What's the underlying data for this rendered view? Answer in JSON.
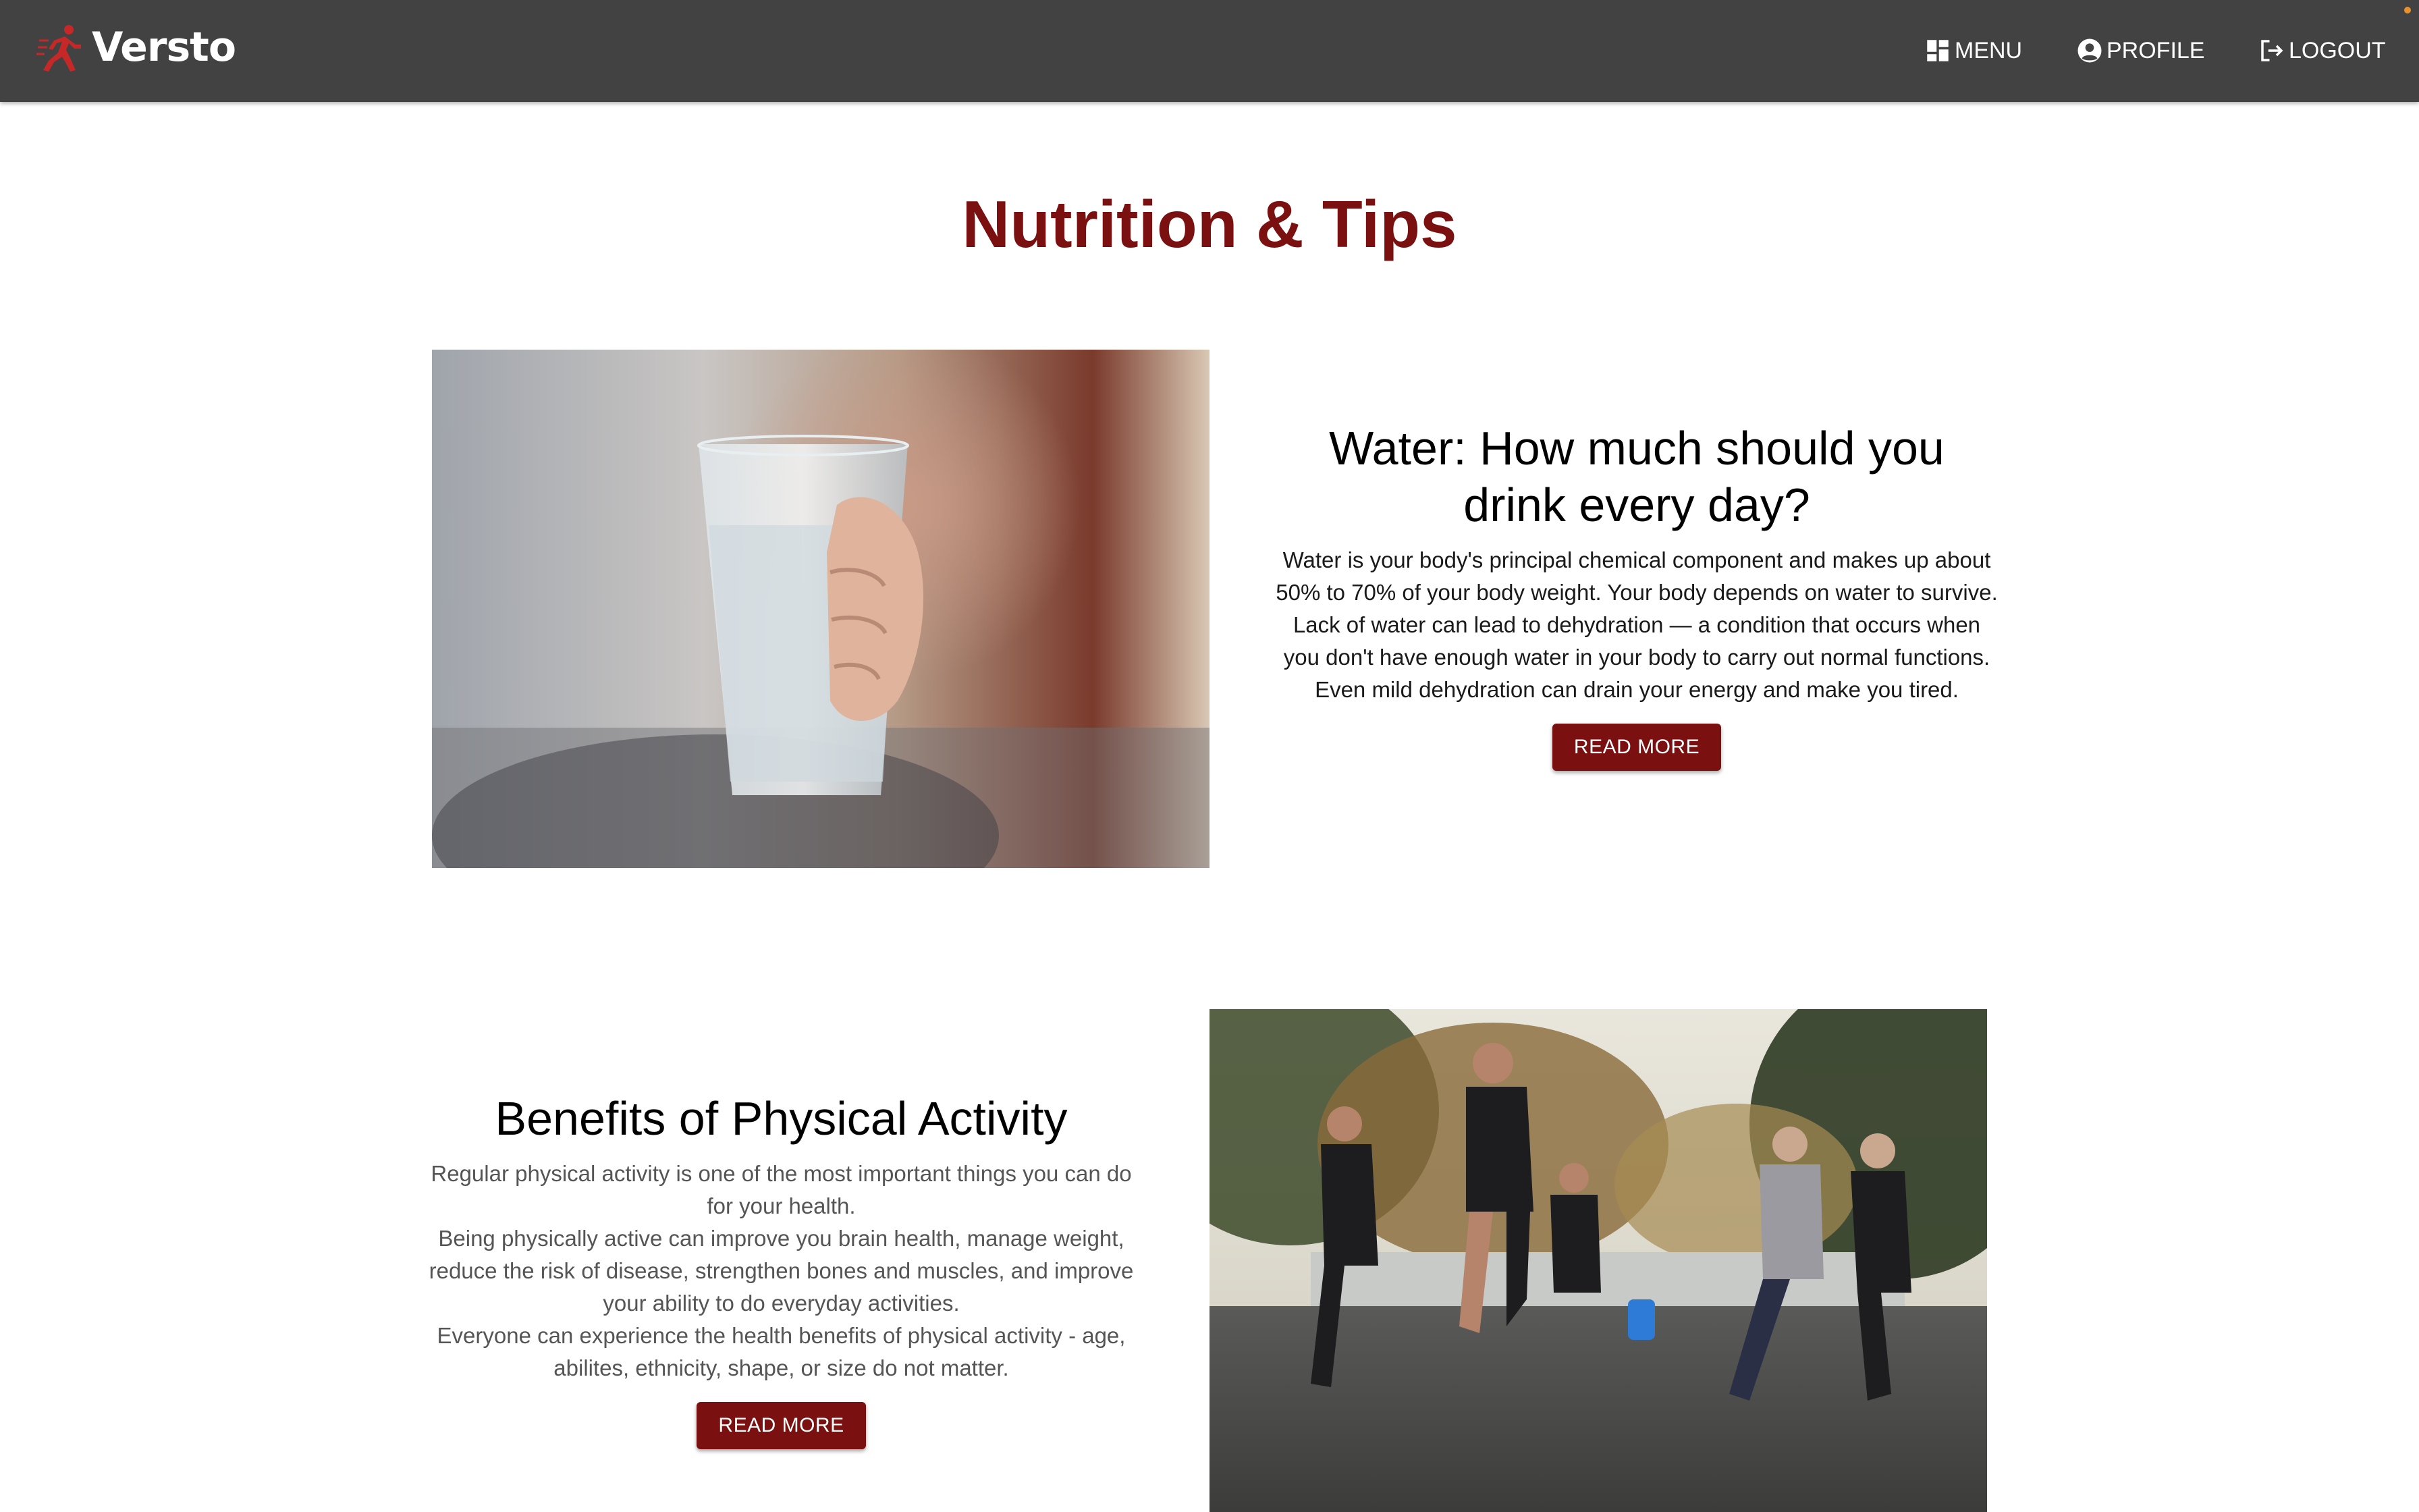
{
  "brand": {
    "name": "Versto",
    "logo_icon": "runner-icon",
    "logo_color": "#b71c1c"
  },
  "nav": {
    "menu_label": "MENU",
    "profile_label": "PROFILE",
    "logout_label": "LOGOUT"
  },
  "page": {
    "title": "Nutrition & Tips",
    "accent_color": "#7b1010",
    "navbar_color": "#424242"
  },
  "articles": [
    {
      "title": "Water: How much should you drink every day?",
      "paragraphs": [
        "Water is your body's principal chemical component and makes up about 50% to 70% of your body weight. Your body depends on water to survive.",
        "Lack of water can lead to dehydration — a condition that occurs when you don't have enough water in your body to carry out normal functions. Even mild dehydration can drain your energy and make you tired."
      ],
      "button_label": "READ MORE"
    },
    {
      "title": "Benefits of Physical Activity",
      "paragraphs": [
        "Regular physical activity is one of the most important things you can do for your health.",
        "Being physically active can improve you brain health, manage weight, reduce the risk of disease, strengthen bones and muscles, and improve your ability to do everyday activities.",
        "Everyone can experience the health benefits of physical activity - age, abilites, ethnicity, shape, or size do not matter."
      ],
      "button_label": "READ MORE"
    }
  ]
}
